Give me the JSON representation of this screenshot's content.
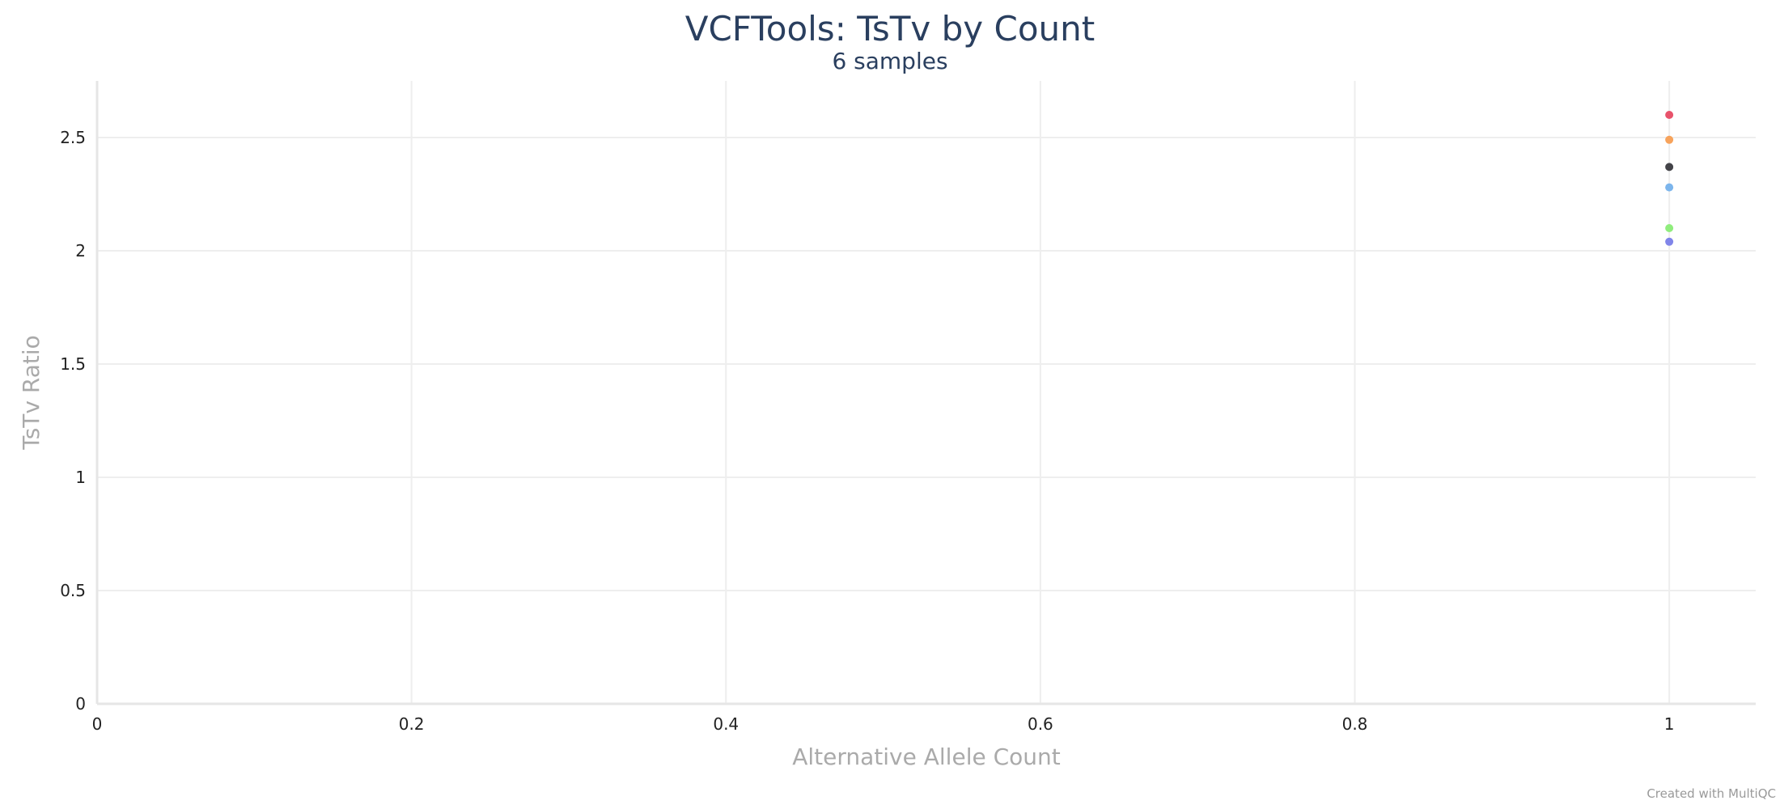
{
  "chart_data": {
    "type": "scatter",
    "title": "VCFTools: TsTv by Count",
    "subtitle": "6 samples",
    "xlabel": "Alternative Allele Count",
    "ylabel": "TsTv Ratio",
    "xlim": [
      0,
      1.055
    ],
    "ylim": [
      0,
      2.75
    ],
    "xticks": [
      0,
      0.2,
      0.4,
      0.6,
      0.8,
      1
    ],
    "xtick_labels": [
      "0",
      "0.2",
      "0.4",
      "0.6",
      "0.8",
      "1"
    ],
    "yticks": [
      0,
      0.5,
      1,
      1.5,
      2,
      2.5
    ],
    "ytick_labels": [
      "0",
      "0.5",
      "1",
      "1.5",
      "2",
      "2.5"
    ],
    "grid": true,
    "legend": "none",
    "series": [
      {
        "color": "#e8536b",
        "x": [
          1
        ],
        "y": [
          2.6
        ]
      },
      {
        "color": "#f7a35c",
        "x": [
          1
        ],
        "y": [
          2.49
        ]
      },
      {
        "color": "#434348",
        "x": [
          1
        ],
        "y": [
          2.37
        ]
      },
      {
        "color": "#7cb5ec",
        "x": [
          1
        ],
        "y": [
          2.28
        ]
      },
      {
        "color": "#90ed7d",
        "x": [
          1
        ],
        "y": [
          2.1
        ]
      },
      {
        "color": "#8085e9",
        "x": [
          1
        ],
        "y": [
          2.04
        ]
      }
    ]
  },
  "credit": "Created with MultiQC"
}
